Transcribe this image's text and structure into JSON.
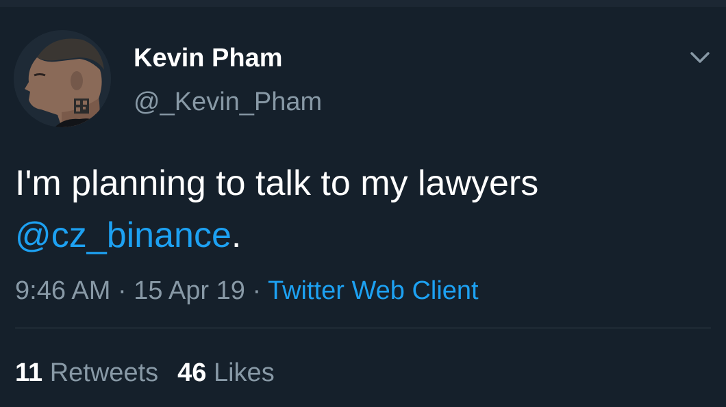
{
  "tweet": {
    "author": {
      "display_name": "Kevin Pham",
      "handle": "@_Kevin_Pham",
      "avatar": "profile-photo"
    },
    "text_main": "I'm planning to talk to my lawyers",
    "mention": "@cz_binance",
    "text_end": ".",
    "time": "9:46 AM",
    "date": "15 Apr 19",
    "separator": "·",
    "source": "Twitter Web Client",
    "retweet_count": "11",
    "retweet_label": "Retweets",
    "like_count": "46",
    "like_label": "Likes"
  },
  "colors": {
    "background": "#15202b",
    "link": "#1da1f2",
    "secondary_text": "#8899a6",
    "divider": "#38444d"
  },
  "icons": {
    "menu": "chevron-down-icon"
  }
}
